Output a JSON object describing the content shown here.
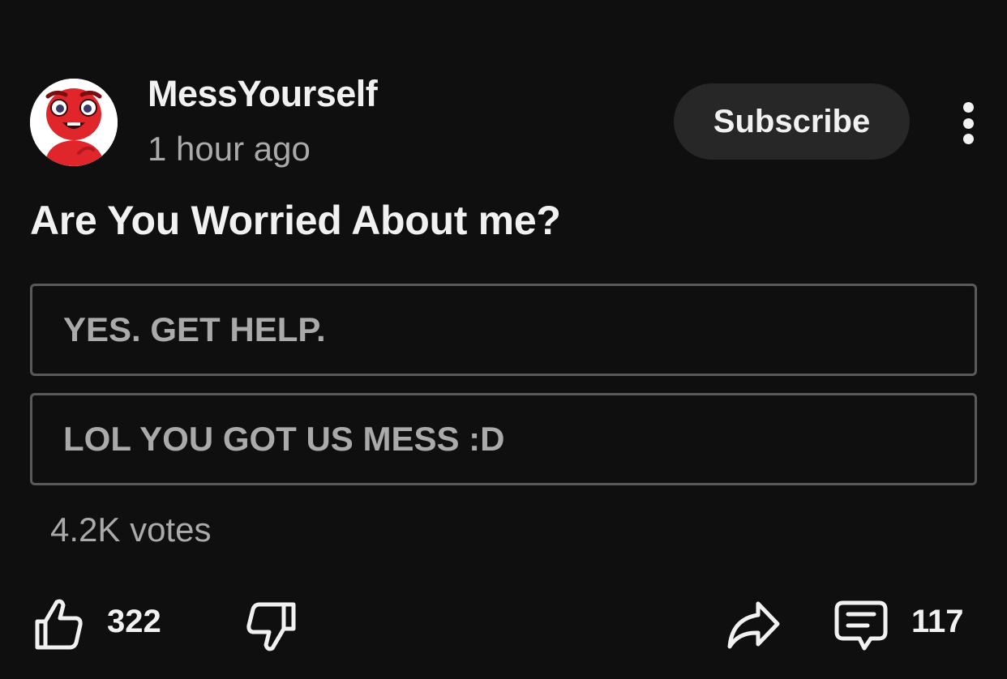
{
  "post": {
    "channel_name": "MessYourself",
    "timestamp": "1 hour ago",
    "subscribe_label": "Subscribe",
    "question": "Are You Worried About me?",
    "options": [
      {
        "label": "YES. GET HELP."
      },
      {
        "label": "LOL YOU GOT US MESS :D"
      }
    ],
    "votes": "4.2K votes"
  },
  "actions": {
    "like_count": "322",
    "comment_count": "117"
  },
  "icons": {
    "more": "vertical-ellipsis-icon",
    "like": "thumbs-up-icon",
    "dislike": "thumbs-down-icon",
    "share": "share-arrow-icon",
    "comment": "comment-icon"
  },
  "colors": {
    "background": "#0f0f0f",
    "primary_text": "#f1f1f1",
    "secondary_text": "#aaaaaa",
    "button_bg": "#272727",
    "option_border": "#5a5a5a",
    "avatar_red": "#e0252b"
  }
}
